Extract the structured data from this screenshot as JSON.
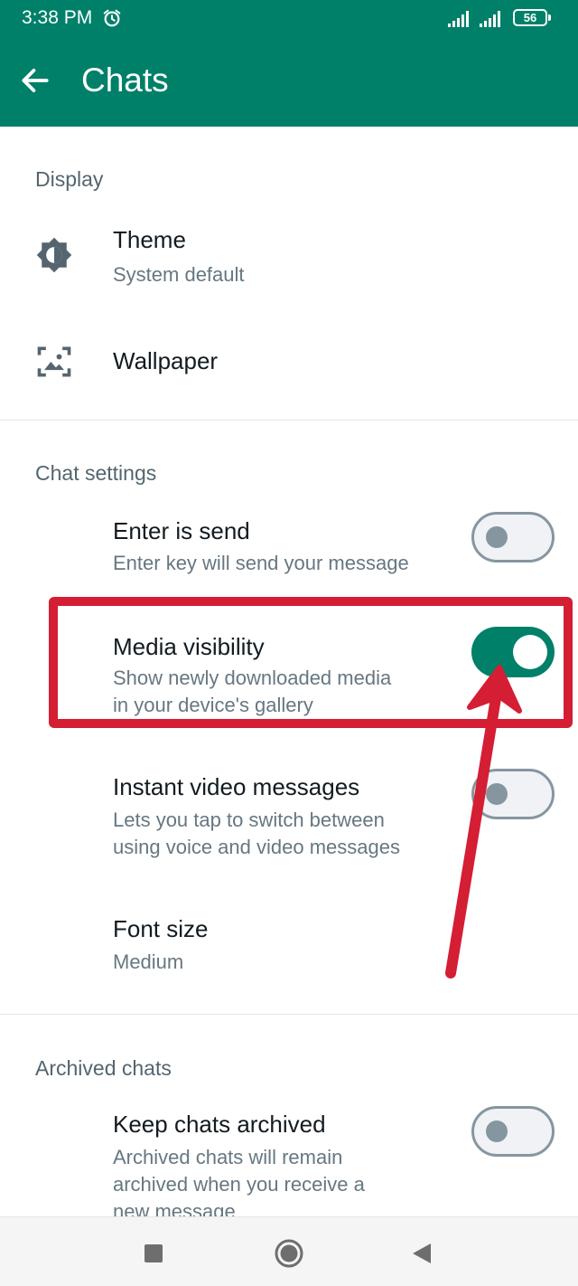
{
  "status_bar": {
    "time": "3:38 PM",
    "battery": "56",
    "icons": [
      "alarm-icon",
      "signal-icon",
      "signal-icon",
      "battery-icon"
    ]
  },
  "header": {
    "title": "Chats",
    "back_icon": "back-arrow-icon",
    "background_color": "#008069"
  },
  "sections": {
    "display": {
      "title": "Display",
      "theme": {
        "title": "Theme",
        "subtitle": "System default",
        "icon": "brightness-icon"
      },
      "wallpaper": {
        "title": "Wallpaper",
        "icon": "wallpaper-icon"
      }
    },
    "chat_settings": {
      "title": "Chat settings",
      "enter_is_send": {
        "title": "Enter is send",
        "subtitle": "Enter key will send your message",
        "enabled": false
      },
      "media_visibility": {
        "title": "Media visibility",
        "subtitle_line1": "Show newly downloaded media",
        "subtitle_line2": "in your device's gallery",
        "enabled": true
      },
      "instant_video": {
        "title": "Instant video messages",
        "subtitle_line1": "Lets you tap to switch between",
        "subtitle_line2": "using voice and video messages",
        "enabled": false
      },
      "font_size": {
        "title": "Font size",
        "subtitle": "Medium"
      }
    },
    "archived_chats": {
      "title": "Archived chats",
      "keep_archived": {
        "title": "Keep chats archived",
        "subtitle_line1": "Archived chats will remain",
        "subtitle_line2": "archived when you receive a",
        "subtitle_line3": "new message",
        "enabled": false
      }
    }
  },
  "annotation": {
    "color": "#d41e33",
    "highlighted_setting": "Media visibility"
  },
  "nav_bar": {
    "buttons": [
      "recents-button",
      "home-button",
      "back-button"
    ]
  },
  "colors": {
    "accent": "#008069",
    "section_title": "#54656f",
    "subtitle": "#667781"
  }
}
